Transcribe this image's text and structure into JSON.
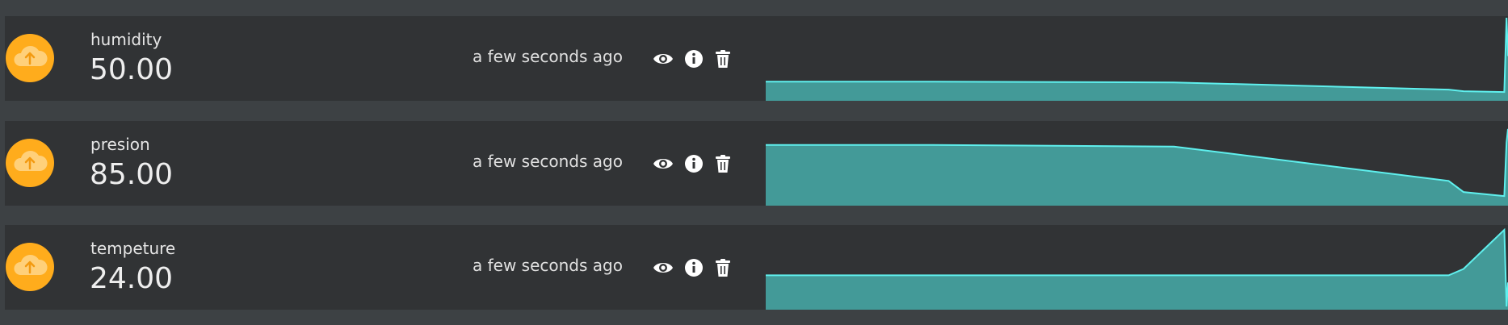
{
  "variables": [
    {
      "name": "humidity",
      "value": "50.00",
      "timestamp": "a few seconds ago",
      "icon": "cloud-upload-icon",
      "series": [
        0.2,
        0.2,
        0.19,
        0.1,
        0.08,
        0.07,
        1.0,
        0.52
      ]
    },
    {
      "name": "presion",
      "value": "85.00",
      "timestamp": "a few seconds ago",
      "icon": "cloud-upload-icon",
      "series": [
        0.72,
        0.72,
        0.7,
        0.27,
        0.13,
        0.08,
        0.75,
        0.92
      ]
    },
    {
      "name": "tempeture",
      "value": "24.00",
      "timestamp": "a few seconds ago",
      "icon": "cloud-upload-icon",
      "series": [
        0.39,
        0.39,
        0.39,
        0.39,
        0.47,
        0.96,
        0.0,
        0.3
      ]
    }
  ],
  "actions": {
    "view_icon": "eye-icon",
    "info_icon": "info-icon",
    "delete_icon": "trash-icon"
  },
  "colors": {
    "page_bg": "#3d4144",
    "row_bg": "#313335",
    "badge": "#ffac1c",
    "chart_fill": "#439a98",
    "chart_line": "#5ff0ee"
  }
}
